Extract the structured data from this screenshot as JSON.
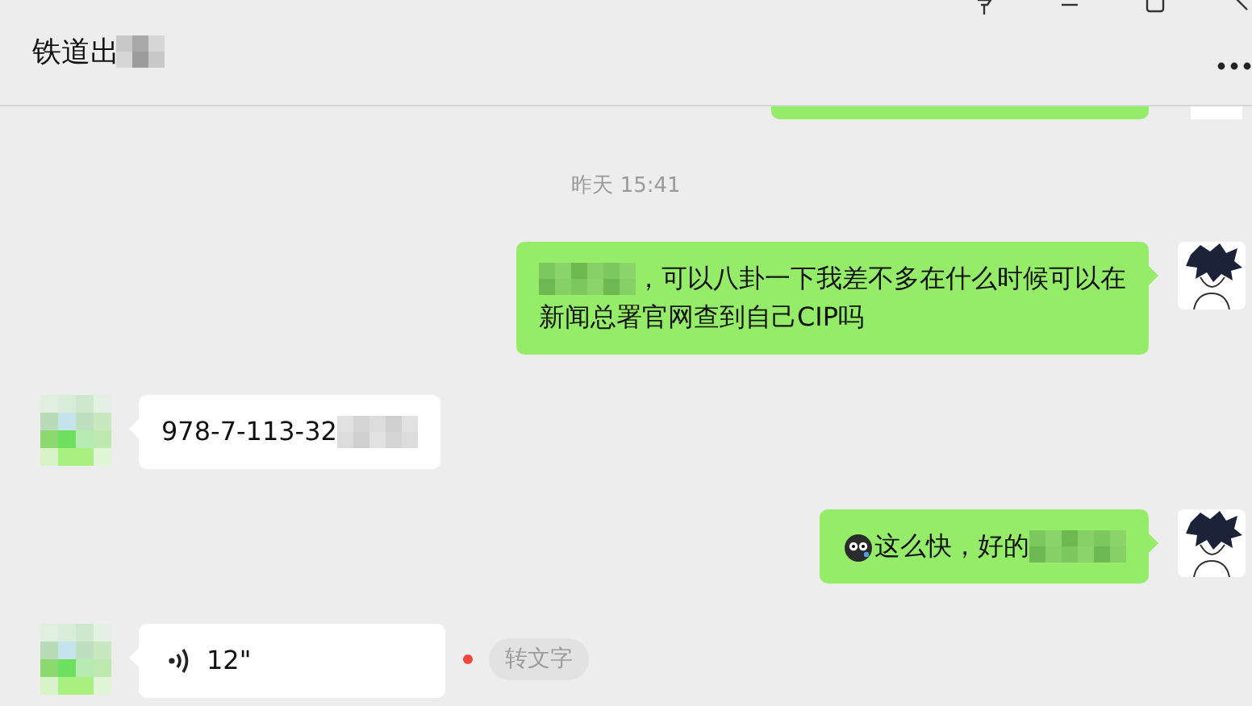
{
  "window": {
    "title": "铁道出"
  },
  "messages": [
    {
      "kind": "cut",
      "outgoing": true
    },
    {
      "kind": "time",
      "text": "昨天 15:41"
    },
    {
      "kind": "text",
      "outgoing": true,
      "lines": [
        [
          {
            "kind": "mosaic"
          },
          {
            "kind": "text",
            "text": "，可以八卦一下我差不多在什么时候可以在"
          }
        ],
        [
          {
            "kind": "text",
            "text": "新闻总署官网查到自己CIP吗"
          }
        ]
      ]
    },
    {
      "kind": "text",
      "outgoing": false,
      "lines": [
        [
          {
            "kind": "text",
            "text": "978-7-113-32"
          },
          {
            "kind": "mosaic"
          }
        ]
      ]
    },
    {
      "kind": "text",
      "outgoing": true,
      "lines": [
        [
          {
            "kind": "emoji"
          },
          {
            "kind": "text",
            "text": "这么快，好的"
          },
          {
            "kind": "mosaic"
          }
        ]
      ]
    },
    {
      "kind": "voice",
      "outgoing": false,
      "duration": "12\"",
      "unread": true,
      "action": "转文字"
    }
  ]
}
